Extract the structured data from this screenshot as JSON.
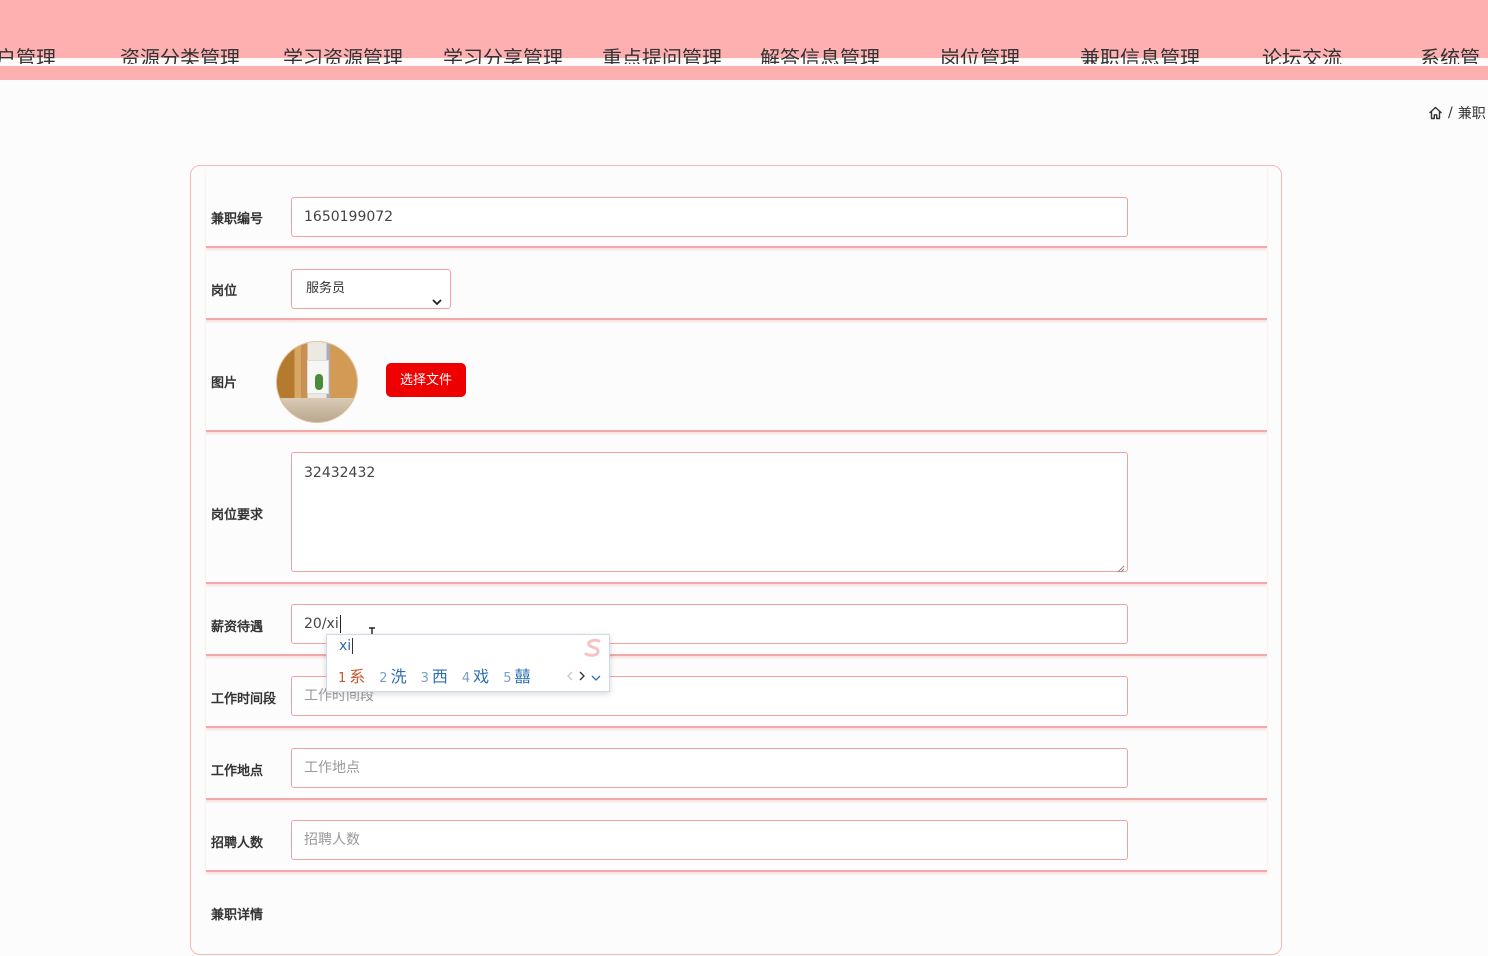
{
  "nav": {
    "items": [
      "户管理",
      "资源分类管理",
      "学习资源管理",
      "学习分享管理",
      "重点提问管理",
      "解答信息管理",
      "岗位管理",
      "兼职信息管理",
      "论坛交流",
      "系统管"
    ]
  },
  "breadcrumb": {
    "current": "兼职"
  },
  "form": {
    "job_number": {
      "label": "兼职编号",
      "value": "1650199072"
    },
    "position": {
      "label": "岗位",
      "selected": "服务员"
    },
    "picture": {
      "label": "图片",
      "button": "选择文件"
    },
    "requirements": {
      "label": "岗位要求",
      "value": "32432432"
    },
    "salary": {
      "label": "薪资待遇",
      "value": "20/xi"
    },
    "work_time": {
      "label": "工作时间段",
      "placeholder": "工作时间段"
    },
    "work_place": {
      "label": "工作地点",
      "placeholder": "工作地点"
    },
    "hire_count": {
      "label": "招聘人数",
      "placeholder": "招聘人数"
    },
    "details": {
      "label": "兼职详情"
    }
  },
  "ime": {
    "composition": "xi",
    "candidates": [
      {
        "num": "1",
        "char": "系"
      },
      {
        "num": "2",
        "char": "洗"
      },
      {
        "num": "3",
        "char": "西"
      },
      {
        "num": "4",
        "char": "戏"
      },
      {
        "num": "5",
        "char": "囍"
      }
    ]
  },
  "colors": {
    "header_bg": "#feb0b0",
    "border_pink": "#f2a0a0",
    "button_red": "#ee0000"
  }
}
